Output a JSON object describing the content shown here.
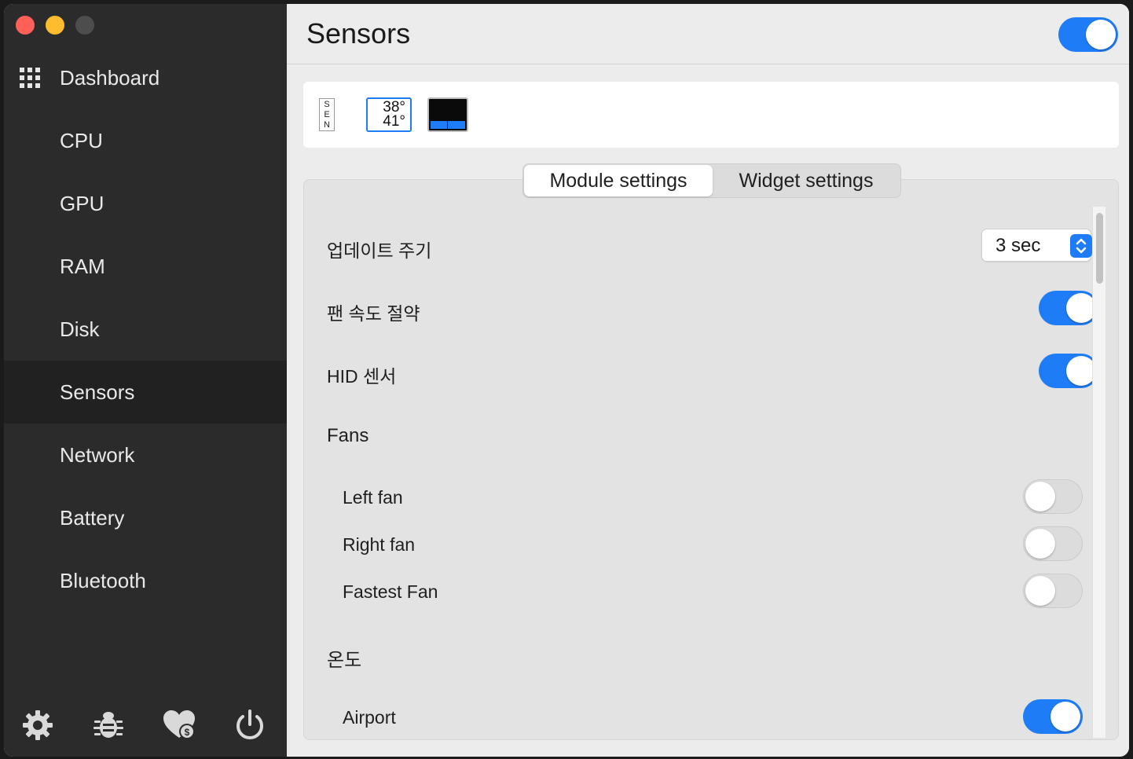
{
  "window": {
    "traffic_lights": [
      "close",
      "minimize",
      "zoom"
    ]
  },
  "sidebar": {
    "items": [
      {
        "label": "Dashboard",
        "icon": "grid-icon"
      },
      {
        "label": "CPU"
      },
      {
        "label": "GPU"
      },
      {
        "label": "RAM"
      },
      {
        "label": "Disk"
      },
      {
        "label": "Sensors",
        "active": true
      },
      {
        "label": "Network"
      },
      {
        "label": "Battery"
      },
      {
        "label": "Bluetooth"
      }
    ],
    "bottom_icons": [
      "gear-icon",
      "bug-icon",
      "heart-donate-icon",
      "power-icon"
    ]
  },
  "header": {
    "title": "Sensors",
    "module_enabled": true
  },
  "widgets": {
    "sen_letters": [
      "S",
      "E",
      "N"
    ],
    "temp_line1": "38°",
    "temp_line2": "41°"
  },
  "tabs": {
    "module": "Module settings",
    "widget": "Widget settings",
    "active": "module"
  },
  "settings": {
    "update_interval_label": "업데이트 주기",
    "update_interval_value": "3 sec",
    "fan_save_label": "팬 속도 절약",
    "fan_save_enabled": true,
    "hid_label": "HID 센서",
    "hid_enabled": true,
    "fans_heading": "Fans",
    "fans": [
      {
        "label": "Left fan",
        "enabled": false
      },
      {
        "label": "Right fan",
        "enabled": false
      },
      {
        "label": "Fastest Fan",
        "enabled": false
      }
    ],
    "temp_heading": "온도",
    "temps": [
      {
        "label": "Airport",
        "enabled": true
      }
    ]
  },
  "colors": {
    "accent": "#1f7cf7",
    "sidebar_bg": "#2b2b2b",
    "sidebar_active": "#212121",
    "main_bg": "#ececec"
  }
}
